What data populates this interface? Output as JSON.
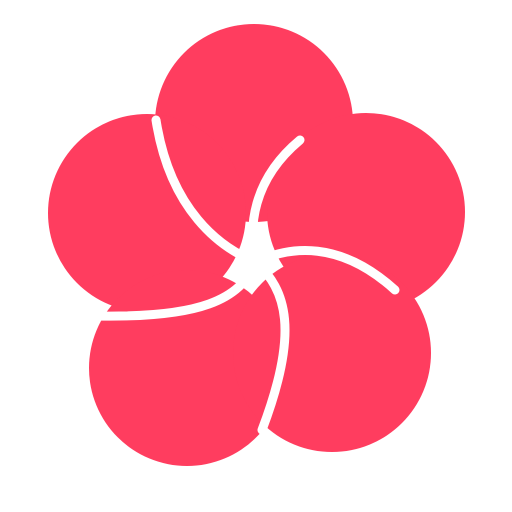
{
  "logo": {
    "icon": "plum-blossom-icon",
    "petal_count": 5,
    "colors": {
      "petal": "#ff3d5f",
      "background": "#ffffff",
      "gap": "#ffffff"
    }
  }
}
